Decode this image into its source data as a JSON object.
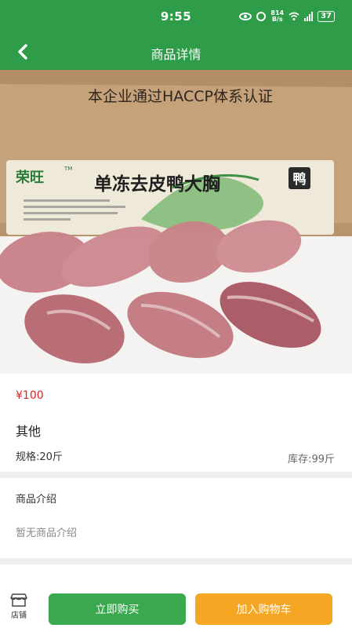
{
  "status_bar": {
    "time": "9:55",
    "speed_top": "814",
    "speed_bottom": "B/s",
    "battery": "37"
  },
  "header": {
    "title": "商品详情",
    "back_icon": "chevron-left-icon"
  },
  "product_image": {
    "box_text": "本企业通过HACCP体系认证",
    "brand": "荣旺",
    "brand_mark": "TM",
    "label_title": "单冻去皮鸭大胸",
    "label_badge": "鸭"
  },
  "product": {
    "price": "¥100",
    "name": "其他",
    "spec": "规格:20斤",
    "stock": "库存:99斤"
  },
  "intro": {
    "heading": "商品介绍",
    "text": "暂无商品介绍"
  },
  "bottom_bar": {
    "store_label": "店铺",
    "store_icon": "store-icon",
    "buy_label": "立即购买",
    "cart_label": "加入购物车"
  },
  "colors": {
    "header_green": "#2e9c48",
    "buy_green": "#3aa84f",
    "cart_orange": "#f5a623",
    "price_red": "#e02020"
  }
}
